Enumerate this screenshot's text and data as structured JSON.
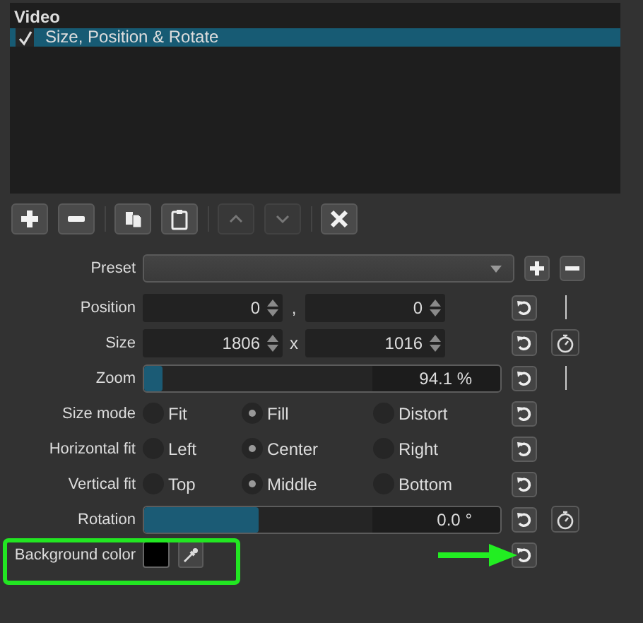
{
  "filters": {
    "header": "Video",
    "items": [
      {
        "label": "Size, Position & Rotate",
        "checked": true,
        "selected": true
      }
    ]
  },
  "toolbar": [
    {
      "kind": "add",
      "disabled": false
    },
    {
      "kind": "remove",
      "disabled": false
    },
    {
      "kind": "copy",
      "disabled": false
    },
    {
      "kind": "paste",
      "disabled": false
    },
    {
      "kind": "up",
      "disabled": true
    },
    {
      "kind": "down",
      "disabled": true
    },
    {
      "kind": "clear",
      "disabled": false
    }
  ],
  "preset": {
    "label": "Preset"
  },
  "rows": [
    {
      "kind": "spin-pair",
      "label": "Position",
      "values": [
        "0",
        "0"
      ],
      "separator": ",",
      "keyframe": {
        "kind": "line"
      }
    },
    {
      "kind": "spin-pair",
      "label": "Size",
      "values": [
        "1806",
        "1016"
      ],
      "separator": "x",
      "keyframe": {
        "kind": "stopwatch"
      }
    },
    {
      "kind": "slider",
      "label": "Zoom",
      "level": 0.05,
      "reading": "94.1 %",
      "keyframe": {
        "kind": "line"
      }
    },
    {
      "kind": "radio",
      "label": "Size mode",
      "options": [
        {
          "label": "Fit",
          "selected": false
        },
        {
          "label": "Fill",
          "selected": true
        },
        {
          "label": "Distort",
          "selected": false
        }
      ]
    },
    {
      "kind": "radio",
      "label": "Horizontal fit",
      "options": [
        {
          "label": "Left",
          "selected": false
        },
        {
          "label": "Center",
          "selected": true
        },
        {
          "label": "Right",
          "selected": false
        }
      ]
    },
    {
      "kind": "radio",
      "label": "Vertical fit",
      "options": [
        {
          "label": "Top",
          "selected": false
        },
        {
          "label": "Middle",
          "selected": true
        },
        {
          "label": "Bottom",
          "selected": false
        }
      ]
    },
    {
      "kind": "slider",
      "label": "Rotation",
      "level": 0.32,
      "reading": "0.0 °",
      "keyframe": {
        "kind": "stopwatch"
      }
    },
    {
      "kind": "color",
      "label": "Background color",
      "color": "#000000"
    }
  ]
}
